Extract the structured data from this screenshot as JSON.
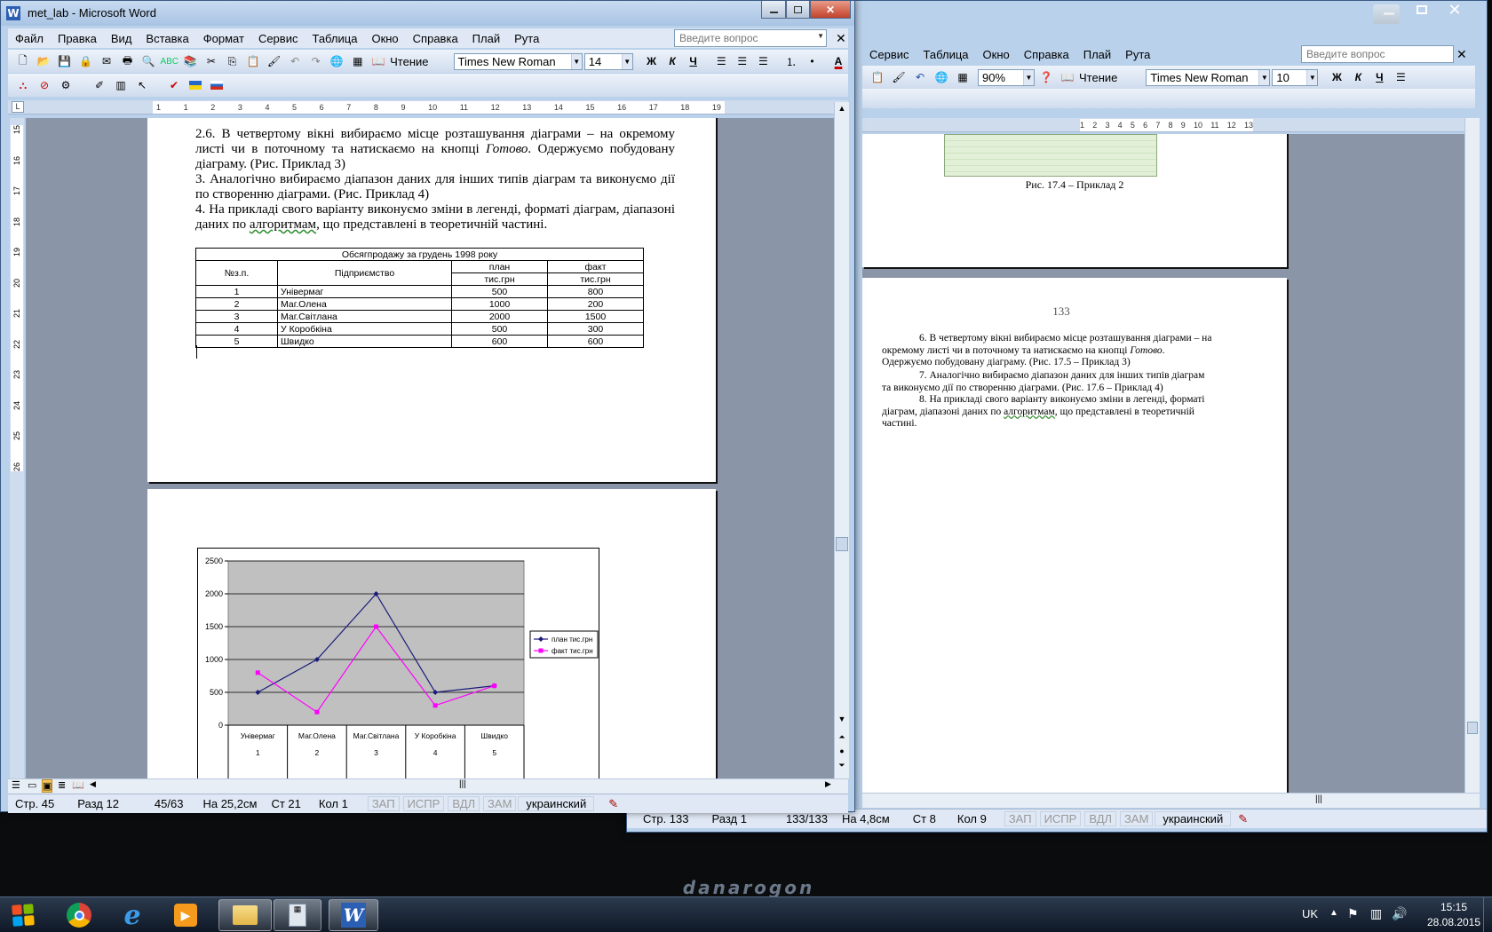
{
  "desktop": {
    "logo_text": "danarogon"
  },
  "back_window": {
    "menu": [
      "Сервис",
      "Таблица",
      "Окно",
      "Справка",
      "Плай",
      "Рута"
    ],
    "ask_placeholder": "Введите вопрос",
    "zoom": "90%",
    "reading_label": "Чтение",
    "font_name": "Times New Roman",
    "font_size": "10",
    "ruler": [
      "1",
      "2",
      "3",
      "4",
      "5",
      "6",
      "7",
      "8",
      "9",
      "10",
      "11",
      "12",
      "13"
    ],
    "caption": "Рис. 17.4 – Приклад 2",
    "page_number": "133",
    "p1_prefix": "6. В четвертому вікні вибираємо місце розташування діаграми – на окремому листі чи в поточному та натискаємо на кнопці ",
    "p1_italic": "Готово",
    "p1_suffix": ". Одержуємо побудовану діаграму. (Рис. 17.5 –  Приклад 3)",
    "p2": "7. Аналогічно вибираємо діапазон даних для інших типів діаграм та виконуємо дії по створенню діаграми. (Рис. 17.6 –   Приклад 4)",
    "p3_prefix": "8. На прикладі свого варіанту виконуємо зміни в легенді, форматі діаграм, діапазоні даних по ",
    "p3_link": "алгоритмам",
    "p3_suffix": ", що представлені в теоретичній частині.",
    "status": {
      "page": "Стр. 133",
      "section": "Разд 1",
      "pages": "133/133",
      "at": "На 4,8см",
      "line": "Ст 8",
      "col": "Кол 9",
      "rec": "ЗАП",
      "trk": "ИСПР",
      "ext": "ВДЛ",
      "ovr": "ЗАМ",
      "lang": "украинский"
    }
  },
  "front_window": {
    "title": "met_lab - Microsoft Word",
    "menu": [
      "Файл",
      "Правка",
      "Вид",
      "Вставка",
      "Формат",
      "Сервис",
      "Таблица",
      "Окно",
      "Справка",
      "Плай",
      "Рута"
    ],
    "ask_placeholder": "Введите вопрос",
    "reading_label": "Чтение",
    "font_name": "Times New Roman",
    "font_size": "14",
    "ruler": [
      "1",
      "1",
      "2",
      "3",
      "4",
      "5",
      "6",
      "7",
      "8",
      "9",
      "10",
      "11",
      "12",
      "13",
      "14",
      "15",
      "16",
      "17",
      "18",
      "19"
    ],
    "vruler": [
      "15",
      "16",
      "17",
      "18",
      "19",
      "20",
      "21",
      "22",
      "23",
      "24",
      "25",
      "26"
    ],
    "p1_prefix": "2.6. В четвертому вікні вибираємо місце розташування діаграми – на окремому листі чи в поточному та натискаємо на кнопці ",
    "p1_italic": "Готово",
    "p1_suffix": ". Одержуємо побудовану діаграму. (Рис. Приклад 3)",
    "p2": "3. Аналогічно вибираємо діапазон даних для інших типів діаграм та виконуємо дії по створенню діаграми. (Рис. Приклад 4)",
    "p3_prefix": "4. На прикладі свого варіанту виконуємо зміни в легенді, форматі діаграм, діапазоні даних по ",
    "p3_link": "алгоритмам",
    "p3_suffix": ", що представлені в теоретичній частині.",
    "table": {
      "title": "Обсягпродажу за грудень 1998 року",
      "col_no": "№з.п.",
      "col_name": "Підприємство",
      "col_plan": "план",
      "col_fact": "факт",
      "unit": "тис.грн",
      "rows": [
        {
          "no": "1",
          "name": "Універмаг",
          "plan": "500",
          "fact": "800"
        },
        {
          "no": "2",
          "name": "Маг.Олена",
          "plan": "1000",
          "fact": "200"
        },
        {
          "no": "3",
          "name": "Маг.Світлана",
          "plan": "2000",
          "fact": "1500"
        },
        {
          "no": "4",
          "name": "У Коробкіна",
          "plan": "500",
          "fact": "300"
        },
        {
          "no": "5",
          "name": "Швидко",
          "plan": "600",
          "fact": "600"
        }
      ]
    },
    "status": {
      "page": "Стр. 45",
      "section": "Разд 12",
      "pages": "45/63",
      "at": "На 25,2см",
      "line": "Ст 21",
      "col": "Кол 1",
      "rec": "ЗАП",
      "trk": "ИСПР",
      "ext": "ВДЛ",
      "ovr": "ЗАМ",
      "lang": "украинский"
    }
  },
  "chart_data": {
    "type": "line",
    "categories": [
      "Універмаг",
      "Маг.Олена",
      "Маг.Світлана",
      "У Коробкіна",
      "Швидко"
    ],
    "category_numbers": [
      "1",
      "2",
      "3",
      "4",
      "5"
    ],
    "series": [
      {
        "name": "план тис.грн",
        "color": "#1a1a7a",
        "values": [
          500,
          1000,
          2000,
          500,
          600
        ]
      },
      {
        "name": "факт тис.грн",
        "color": "#ff00ff",
        "values": [
          800,
          200,
          1500,
          300,
          600
        ]
      }
    ],
    "ylim": [
      0,
      2500
    ],
    "yticks": [
      0,
      500,
      1000,
      1500,
      2000,
      2500
    ],
    "grid": true,
    "plot_background": "#c0c0c0",
    "legend": "right"
  },
  "taskbar": {
    "lang": "UK",
    "time": "15:15",
    "date": "28.08.2015"
  }
}
